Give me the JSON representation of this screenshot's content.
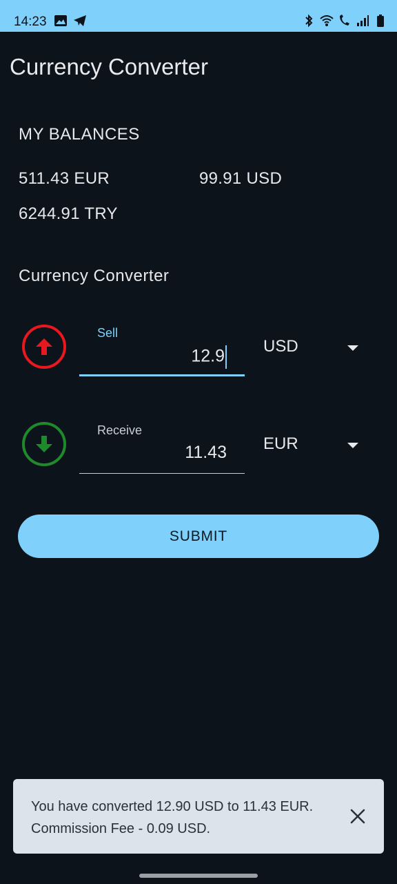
{
  "status_bar": {
    "time": "14:23"
  },
  "app": {
    "title": "Currency Converter"
  },
  "balances": {
    "heading": "MY BALANCES",
    "items": [
      "511.43 EUR",
      "99.91 USD",
      "6244.91 TRY"
    ]
  },
  "converter": {
    "heading": "Currency Converter",
    "sell": {
      "label": "Sell",
      "value": "12.9",
      "currency": "USD"
    },
    "receive": {
      "label": "Receive",
      "value": "11.43",
      "currency": "EUR"
    },
    "submit_label": "SUBMIT"
  },
  "snackbar": {
    "message": "You have converted 12.90 USD to 11.43 EUR. Commission Fee - 0.09 USD."
  },
  "colors": {
    "accent": "#7fd0fb",
    "sell_icon": "#e8181e",
    "receive_icon": "#1f8a2c",
    "background": "#0d131b"
  }
}
